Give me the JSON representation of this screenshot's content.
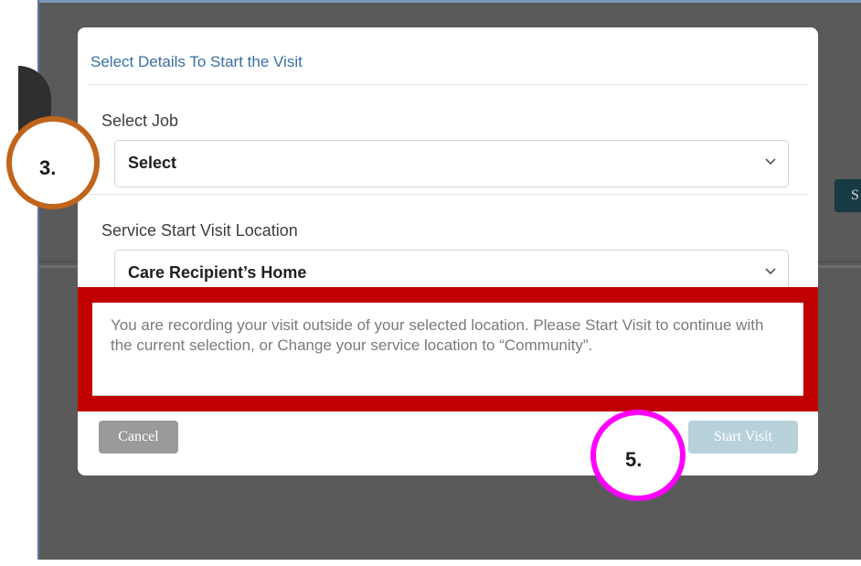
{
  "modal": {
    "title": "Select Details To Start the Visit",
    "job": {
      "label": "Select Job",
      "value": "Select"
    },
    "location": {
      "label": "Service Start Visit Location",
      "value": "Care Recipient’s Home"
    },
    "warning": "You are recording your visit outside of your selected location. Please Start Visit to continue with the current selection, or Change your service location to “Community”.",
    "buttons": {
      "cancel": "Cancel",
      "start": "Start Visit"
    }
  },
  "background": {
    "button_partial_label": "S"
  },
  "callouts": {
    "step3": "3.",
    "step5": "5."
  },
  "colors": {
    "warning_outline": "#c00000",
    "step3_ring": "#c0651c",
    "step5_ring": "#ff00ff",
    "title": "#3a6fa3",
    "start_button": "#b7d2db",
    "cancel_button": "#9a9a9a"
  },
  "icons": {
    "select_chevron": "chevron-down-icon"
  }
}
